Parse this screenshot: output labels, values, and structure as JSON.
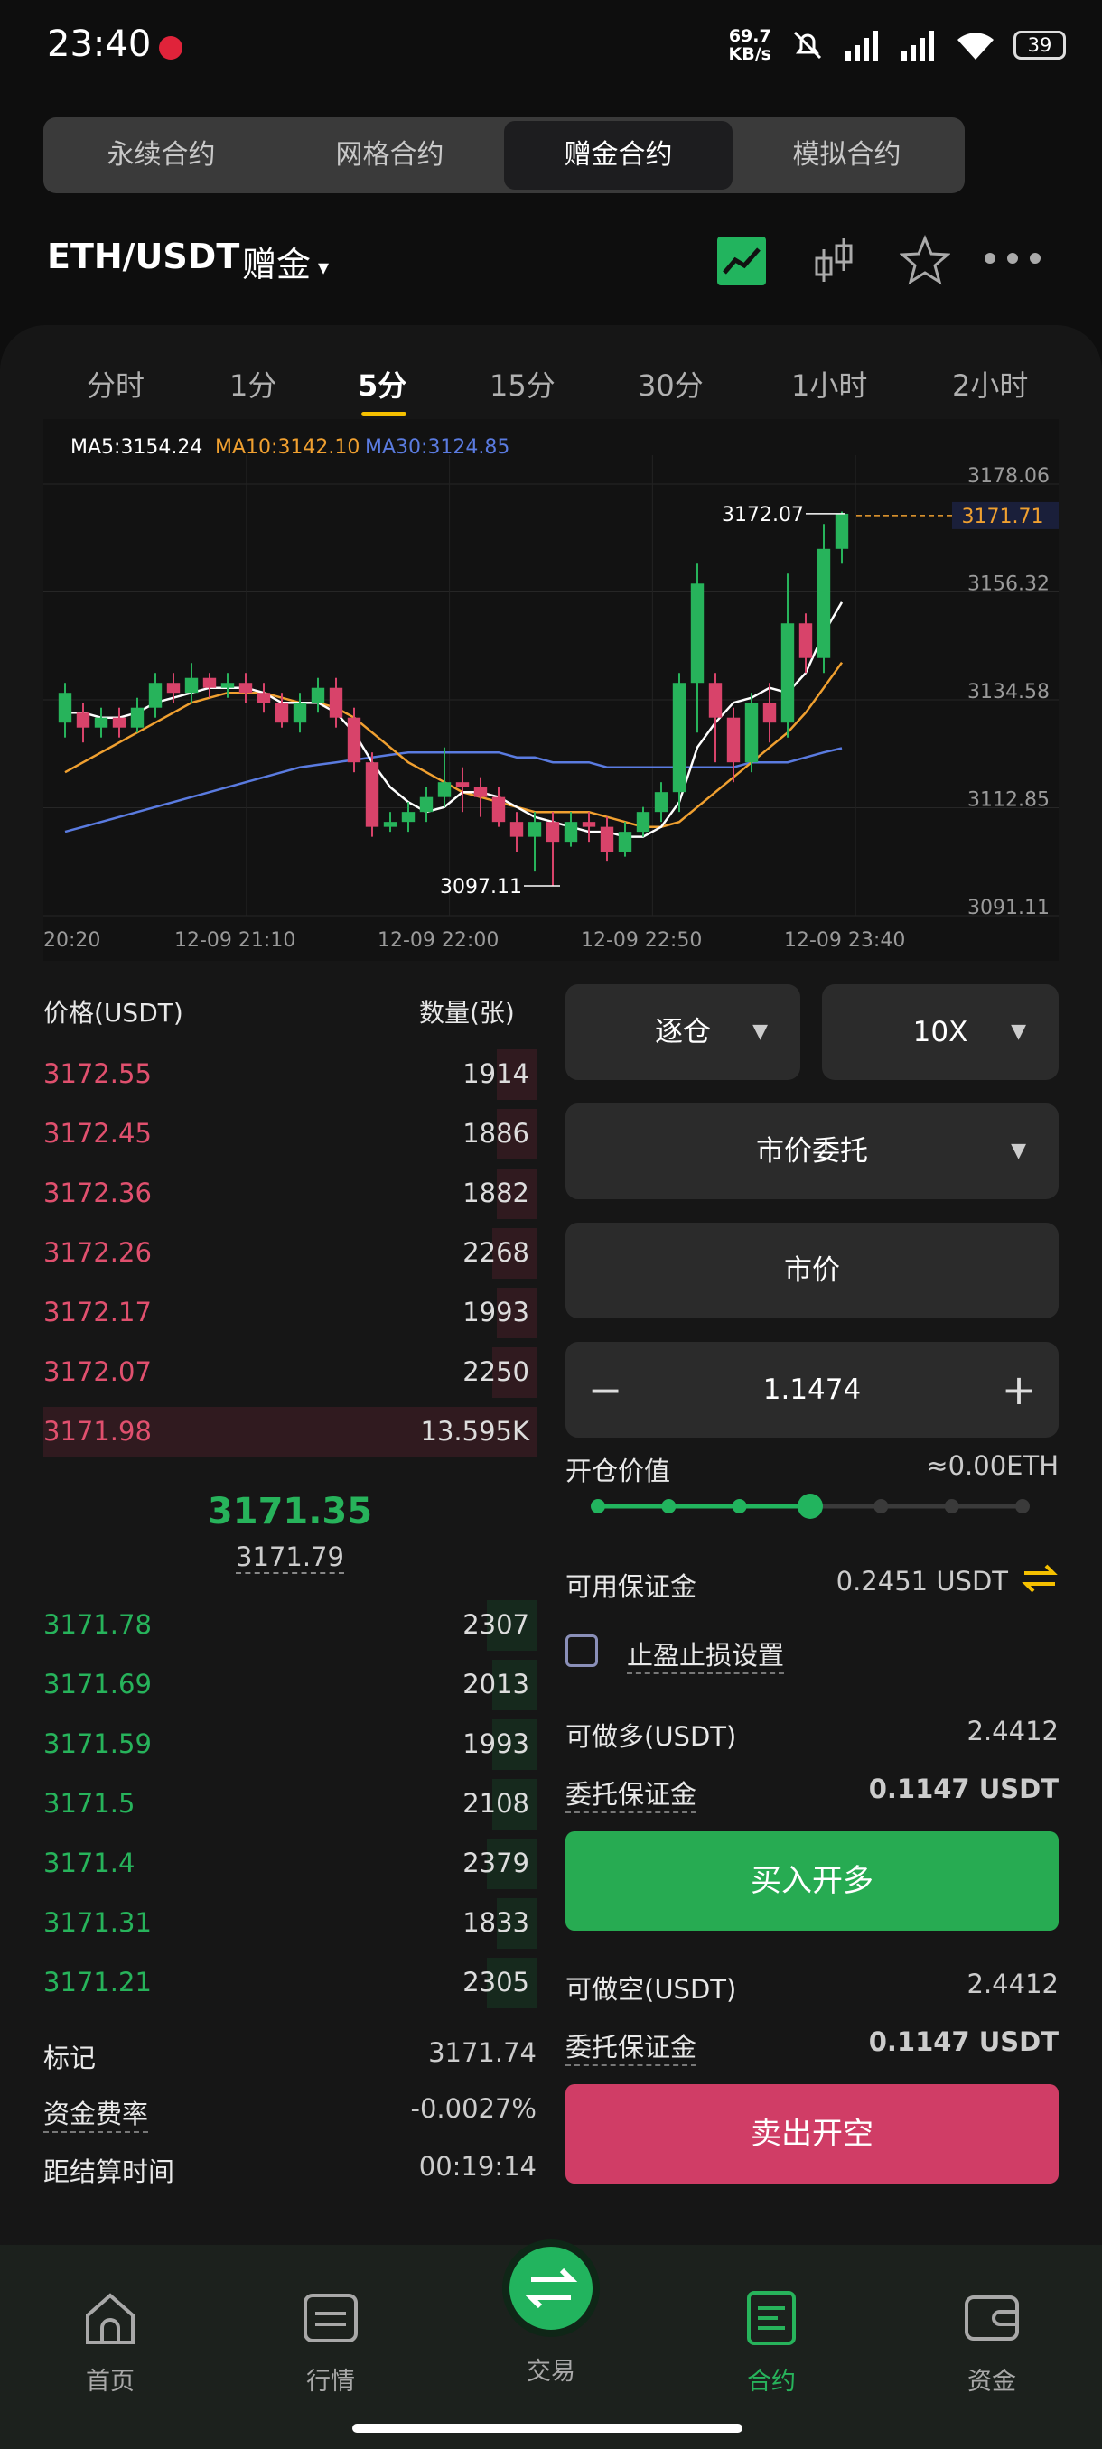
{
  "status": {
    "time": "23:40",
    "speed_value": "69.7",
    "speed_unit": "KB/s",
    "battery": "39"
  },
  "tabs": [
    "永续合约",
    "网格合约",
    "赠金合约",
    "模拟合约"
  ],
  "active_tab": 2,
  "pair": {
    "symbol": "ETH/USDT",
    "type": "赠金",
    "caret": "▾"
  },
  "timeframes": [
    "分时",
    "1分",
    "5分",
    "15分",
    "30分",
    "1小时",
    "2小时"
  ],
  "active_timeframe": 2,
  "ma": {
    "ma5": "MA5:3154.24",
    "ma10": "MA10:3142.10",
    "ma30": "MA30:3124.85"
  },
  "colors": {
    "up": "#27b35b",
    "down": "#d8436a",
    "ma5": "#ffffff",
    "ma10": "#f0a030",
    "ma30": "#5a7be0",
    "accent": "#f5c000"
  },
  "chart_data": {
    "type": "candlestick",
    "y_ticks": [
      "3178.06",
      "3156.32",
      "3134.58",
      "3112.85",
      "3091.11"
    ],
    "ylim": [
      3091.11,
      3178.06
    ],
    "x_ticks": [
      "20:20",
      "12-09  21:10",
      "12-09  22:00",
      "12-09  22:50",
      "12-09  23:40"
    ],
    "current_price_label": "3171.71",
    "high_label": "3172.07",
    "low_label": "3097.11",
    "candles": [
      [
        3130,
        3136,
        3127,
        3138
      ],
      [
        3132,
        3129,
        3126,
        3134
      ],
      [
        3129,
        3131,
        3127,
        3133
      ],
      [
        3131,
        3129,
        3127,
        3133
      ],
      [
        3129,
        3133,
        3128,
        3135
      ],
      [
        3133,
        3138,
        3131,
        3140
      ],
      [
        3138,
        3136,
        3134,
        3140
      ],
      [
        3136,
        3139,
        3134,
        3142
      ],
      [
        3139,
        3137,
        3135,
        3140
      ],
      [
        3137,
        3138,
        3135,
        3140
      ],
      [
        3138,
        3136,
        3134,
        3140
      ],
      [
        3136,
        3134,
        3132,
        3138
      ],
      [
        3134,
        3130,
        3129,
        3136
      ],
      [
        3130,
        3134,
        3128,
        3136
      ],
      [
        3134,
        3137,
        3132,
        3139
      ],
      [
        3137,
        3131,
        3129,
        3139
      ],
      [
        3131,
        3122,
        3120,
        3133
      ],
      [
        3122,
        3109,
        3107,
        3124
      ],
      [
        3109,
        3110,
        3108,
        3112
      ],
      [
        3110,
        3112,
        3108,
        3114
      ],
      [
        3112,
        3115,
        3110,
        3117
      ],
      [
        3115,
        3118,
        3113,
        3125
      ],
      [
        3118,
        3117,
        3112,
        3121
      ],
      [
        3117,
        3115,
        3111,
        3119
      ],
      [
        3115,
        3110,
        3109,
        3117
      ],
      [
        3110,
        3107,
        3104,
        3112
      ],
      [
        3107,
        3110,
        3100,
        3112
      ],
      [
        3110,
        3106,
        3097.11,
        3112
      ],
      [
        3106,
        3110,
        3105,
        3112
      ],
      [
        3110,
        3109,
        3106,
        3112
      ],
      [
        3109,
        3104,
        3102,
        3111
      ],
      [
        3104,
        3108,
        3103,
        3110
      ],
      [
        3108,
        3112,
        3107,
        3113
      ],
      [
        3112,
        3116,
        3110,
        3118
      ],
      [
        3116,
        3138,
        3112,
        3140
      ],
      [
        3138,
        3158,
        3128,
        3162
      ],
      [
        3138,
        3131,
        3122,
        3140
      ],
      [
        3131,
        3122,
        3118,
        3133
      ],
      [
        3122,
        3134,
        3120,
        3136
      ],
      [
        3134,
        3130,
        3126,
        3138
      ],
      [
        3130,
        3150,
        3127,
        3160
      ],
      [
        3150,
        3143,
        3140,
        3152
      ],
      [
        3143,
        3165,
        3140,
        3170
      ],
      [
        3165,
        3172.07,
        3162,
        3172.5
      ]
    ],
    "ma5": [
      3132,
      3132,
      3131,
      3131,
      3132,
      3134,
      3135,
      3136,
      3137,
      3137,
      3137,
      3136,
      3134,
      3134,
      3134,
      3132,
      3128,
      3122,
      3117,
      3114,
      3112,
      3113,
      3116,
      3116,
      3115,
      3113,
      3111,
      3110,
      3109,
      3108,
      3108,
      3107,
      3107,
      3109,
      3114,
      3125,
      3130,
      3134,
      3135,
      3137,
      3136,
      3140,
      3148,
      3154.24
    ],
    "ma10": [
      3120,
      3122,
      3124,
      3126,
      3128,
      3130,
      3132,
      3134,
      3135,
      3136,
      3136,
      3136,
      3135,
      3134,
      3134,
      3133,
      3131,
      3128,
      3125,
      3122,
      3120,
      3118,
      3116,
      3115,
      3114,
      3113,
      3112,
      3112,
      3112,
      3112,
      3111,
      3110,
      3109,
      3109,
      3110,
      3113,
      3116,
      3119,
      3122,
      3125,
      3128,
      3132,
      3137,
      3142.1
    ],
    "ma30": [
      3108,
      3109,
      3110,
      3111,
      3112,
      3113,
      3114,
      3115,
      3116,
      3117,
      3118,
      3119,
      3120,
      3121,
      3121.5,
      3122,
      3122.5,
      3123,
      3123.5,
      3124,
      3124,
      3124,
      3124,
      3124,
      3124,
      3123,
      3123,
      3122,
      3122,
      3122,
      3121,
      3121,
      3121,
      3121,
      3121,
      3121,
      3121,
      3121,
      3122,
      3122,
      3122,
      3123,
      3124,
      3124.85
    ]
  },
  "orderbook": {
    "price_header": "价格(USDT)",
    "qty_header": "数量(张)",
    "asks": [
      {
        "price": "3172.55",
        "qty": "1914",
        "depth": 0.08
      },
      {
        "price": "3172.45",
        "qty": "1886",
        "depth": 0.08
      },
      {
        "price": "3172.36",
        "qty": "1882",
        "depth": 0.08
      },
      {
        "price": "3172.26",
        "qty": "2268",
        "depth": 0.09
      },
      {
        "price": "3172.17",
        "qty": "1993",
        "depth": 0.08
      },
      {
        "price": "3172.07",
        "qty": "2250",
        "depth": 0.09
      },
      {
        "price": "3171.98",
        "qty": "13.595K",
        "depth": 1.0
      }
    ],
    "last_price": "3171.35",
    "mark_price": "3171.79",
    "bids": [
      {
        "price": "3171.78",
        "qty": "2307",
        "depth": 0.1
      },
      {
        "price": "3171.69",
        "qty": "2013",
        "depth": 0.09
      },
      {
        "price": "3171.59",
        "qty": "1993",
        "depth": 0.09
      },
      {
        "price": "3171.5",
        "qty": "2108",
        "depth": 0.09
      },
      {
        "price": "3171.4",
        "qty": "2379",
        "depth": 0.1
      },
      {
        "price": "3171.31",
        "qty": "1833",
        "depth": 0.08
      },
      {
        "price": "3171.21",
        "qty": "2305",
        "depth": 0.1
      }
    ]
  },
  "market_info": {
    "mark_label": "标记",
    "mark_value": "3171.74",
    "funding_label": "资金费率",
    "funding_value": "-0.0027%",
    "settle_label": "距结算时间",
    "settle_value": "00:19:14"
  },
  "form": {
    "margin_mode": "逐仓",
    "leverage": "10X",
    "order_type": "市价委托",
    "price": "市价",
    "quantity": "1.1474",
    "minus": "−",
    "plus": "+",
    "open_value_label": "开仓价值",
    "open_value": "≈0.00ETH",
    "slider_level": 0.5,
    "avail_label": "可用保证金",
    "avail_value": "0.2451 USDT",
    "tpsl_label": "止盈止损设置",
    "long_label": "可做多(USDT)",
    "long_value": "2.4412",
    "long_margin_label": "委托保证金",
    "long_margin_value": "0.1147 USDT",
    "buy_button": "买入开多",
    "short_label": "可做空(USDT)",
    "short_value": "2.4412",
    "short_margin_label": "委托保证金",
    "short_margin_value": "0.1147 USDT",
    "sell_button": "卖出开空"
  },
  "nav": {
    "home": "首页",
    "market": "行情",
    "trade": "交易",
    "contract": "合约",
    "assets": "资金"
  }
}
